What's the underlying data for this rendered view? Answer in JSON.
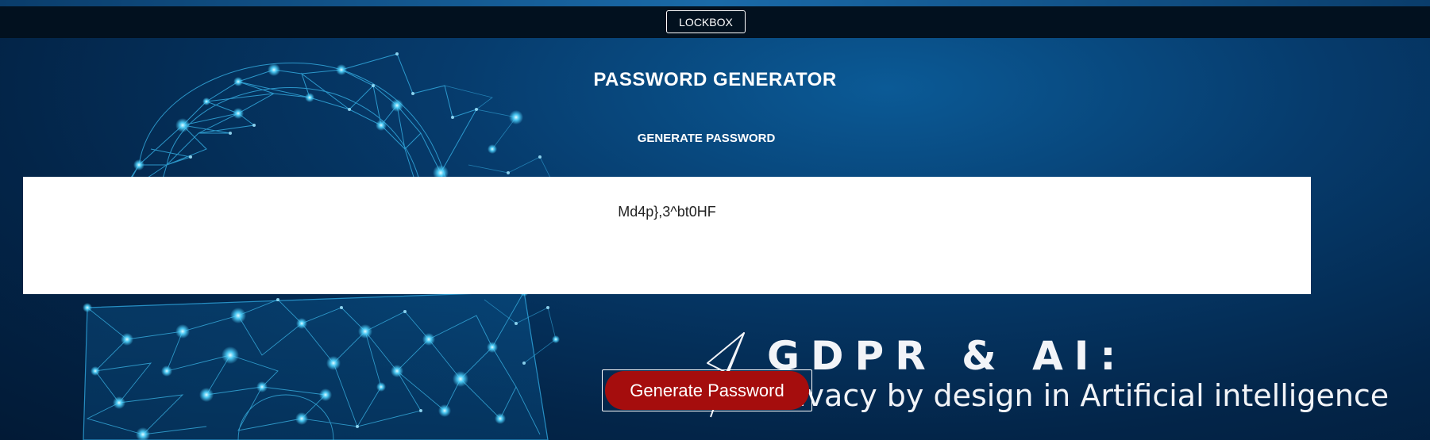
{
  "navbar": {
    "brand_label": "LOCKBOX"
  },
  "main": {
    "title": "PASSWORD GENERATOR",
    "subtitle": "GENERATE PASSWORD",
    "password_value": "Md4p},3^bt0HF",
    "generate_button_label": "Generate Password"
  },
  "background": {
    "banner_title": "GDPR & AI:",
    "banner_subtitle": "ivacy by design in Artificial intelligence"
  },
  "colors": {
    "navbar_bg": "#02111f",
    "page_bg": "#063b6c",
    "button_bg": "#a50d0d",
    "network_glow": "#4fd4ff"
  },
  "icons": {
    "background_art": "padlock-network-illustration"
  }
}
